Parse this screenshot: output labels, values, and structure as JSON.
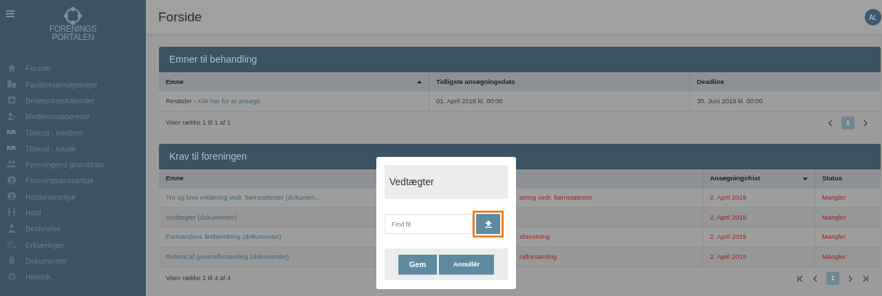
{
  "sidebar": {
    "logo_lines": [
      "FORENINGS",
      "PORTALEN"
    ],
    "items": [
      {
        "label": "Forside"
      },
      {
        "label": "Facilitetsansøgninger"
      },
      {
        "label": "Belægningskalender"
      },
      {
        "label": "Medlemsopgørelse"
      },
      {
        "label": "Tilskud - medlem",
        "badge": "KR"
      },
      {
        "label": "Tilskud - lokale",
        "badge": "KR"
      },
      {
        "label": "Foreningens grunddata"
      },
      {
        "label": "Foreningsansvarlige"
      },
      {
        "label": "Holdansvarlige"
      },
      {
        "label": "Hold"
      },
      {
        "label": "Bestyrelse"
      },
      {
        "label": "Erklæringer"
      },
      {
        "label": "Dokumenter"
      },
      {
        "label": "Historik"
      }
    ]
  },
  "header": {
    "title": "Forside",
    "avatar": "AL"
  },
  "panels": [
    {
      "title": "Emner til behandling",
      "columns": [
        {
          "label": "Emne",
          "sorted_ascending": true
        },
        {
          "label": "Tidligste ansøgningsdato"
        },
        {
          "label": "Deadline"
        }
      ],
      "rows": [
        {
          "cells": [
            {
              "text": "Resttider - ",
              "link": "Klik her for at ansøge."
            },
            {
              "text": "01. April 2018 kl. 00:00"
            },
            {
              "text": "30. Juni 2019 kl. 00:00"
            }
          ]
        }
      ],
      "footer": "Viser række 1 til 1 af 1",
      "pager": {
        "first_last": false,
        "page": "1",
        "selected": true
      }
    },
    {
      "title": "Krav til foreningen",
      "columns": [
        {
          "label": "Emne"
        },
        {
          "label": "Ansøgningsfrist",
          "sorted_descending": true
        },
        {
          "label": "Status"
        }
      ],
      "rows": [
        {
          "covered_text": "æring vedr. børneattester",
          "cells": [
            {
              "text": "Tro og love erklæring vedr. børneattester (dokumen...",
              "kind": "link"
            },
            {
              "text": "2. April 2019",
              "missing": true
            },
            {
              "text": "Mangler",
              "missing": true
            }
          ]
        },
        {
          "cells": [
            {
              "text": "Vedtægter (dokumenter)",
              "kind": "link"
            },
            {
              "text": "2. April 2019",
              "missing": true
            },
            {
              "text": "Mangler",
              "missing": true
            }
          ]
        },
        {
          "covered_text": "sberetning",
          "cells": [
            {
              "text": "Formandens årsberetning (dokumenter)",
              "kind": "link"
            },
            {
              "text": "2. April 2019",
              "missing": true
            },
            {
              "text": "Mangler",
              "missing": true
            }
          ]
        },
        {
          "covered_text": "ralforsamling",
          "cells": [
            {
              "text": "Referat af generalforsamling (dokumenter)",
              "kind": "link"
            },
            {
              "text": "2. April 2019",
              "missing": true
            },
            {
              "text": "Mangler",
              "missing": true
            }
          ]
        }
      ],
      "footer": "Viser række 1 til 4 af 4",
      "pager": {
        "first_last": true,
        "page": "1",
        "selected": true
      }
    }
  ],
  "dialog": {
    "title": "Vedtægter",
    "file_field": {
      "placeholder": "Find fil"
    },
    "upload_highlighted": true,
    "buttons": [
      "Gem",
      "Annullér"
    ]
  }
}
